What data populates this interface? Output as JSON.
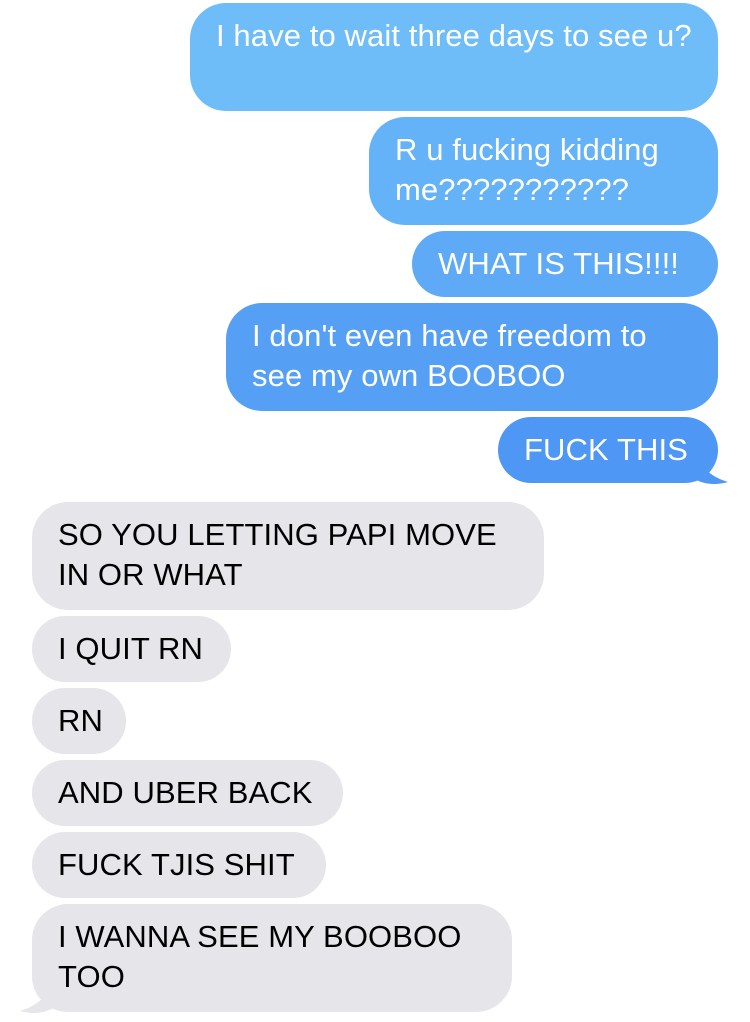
{
  "conversation": {
    "sent": [
      {
        "text": "I have to wait three days to see u?"
      },
      {
        "text": "R u fucking kidding me???????????"
      },
      {
        "text": "WHAT IS THIS!!!!"
      },
      {
        "text": "I don't even have freedom to see my own BOOBOO"
      },
      {
        "text": "FUCK THIS"
      }
    ],
    "received": [
      {
        "text": "SO YOU LETTING PAPI MOVE IN OR WHAT"
      },
      {
        "text": "I QUIT RN"
      },
      {
        "text": "RN"
      },
      {
        "text": "AND UBER BACK"
      },
      {
        "text": "FUCK TJIS SHIT"
      },
      {
        "text": "I WANNA SEE MY BOOBOO TOO"
      }
    ]
  },
  "colors": {
    "sent_bubble_top": "#6fbdf8",
    "sent_bubble_bottom": "#4e97f4",
    "received_bubble": "#e5e5ea",
    "sent_text": "#ffffff",
    "received_text": "#000000"
  }
}
